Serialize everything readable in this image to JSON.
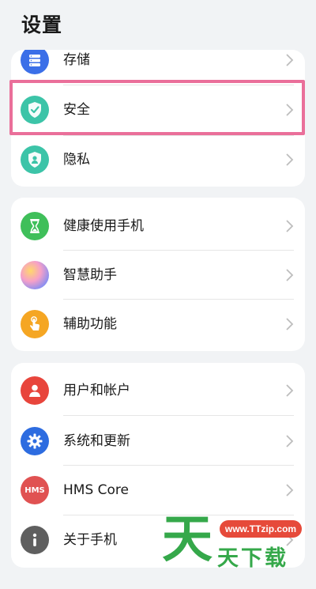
{
  "page": {
    "title": "设置"
  },
  "groups": [
    {
      "items": [
        {
          "label": "存储",
          "icon": "storage-icon",
          "color": "#3b6fe8"
        },
        {
          "label": "安全",
          "icon": "shield-check-icon",
          "color": "#3cc4a8"
        },
        {
          "label": "隐私",
          "icon": "privacy-shield-icon",
          "color": "#3cc4a8"
        }
      ]
    },
    {
      "items": [
        {
          "label": "健康使用手机",
          "icon": "hourglass-icon",
          "color": "#3fbf5a"
        },
        {
          "label": "智慧助手",
          "icon": "assistant-orb-icon",
          "color": "#f08ab0"
        },
        {
          "label": "辅助功能",
          "icon": "touch-hand-icon",
          "color": "#f5a623"
        }
      ]
    },
    {
      "items": [
        {
          "label": "用户和帐户",
          "icon": "user-icon",
          "color": "#e8453c"
        },
        {
          "label": "系统和更新",
          "icon": "gear-icon",
          "color": "#2d6ce0"
        },
        {
          "label": "HMS Core",
          "icon": "hms-icon",
          "color": "#e05252",
          "badge": "HMS"
        },
        {
          "label": "关于手机",
          "icon": "info-icon",
          "color": "#5f5f5f"
        }
      ]
    }
  ],
  "highlight": {
    "target": "安全",
    "color": "#ea6f9a"
  },
  "watermark": {
    "url": "www.TTzip.com",
    "big_char": "天",
    "text": "天下载"
  }
}
